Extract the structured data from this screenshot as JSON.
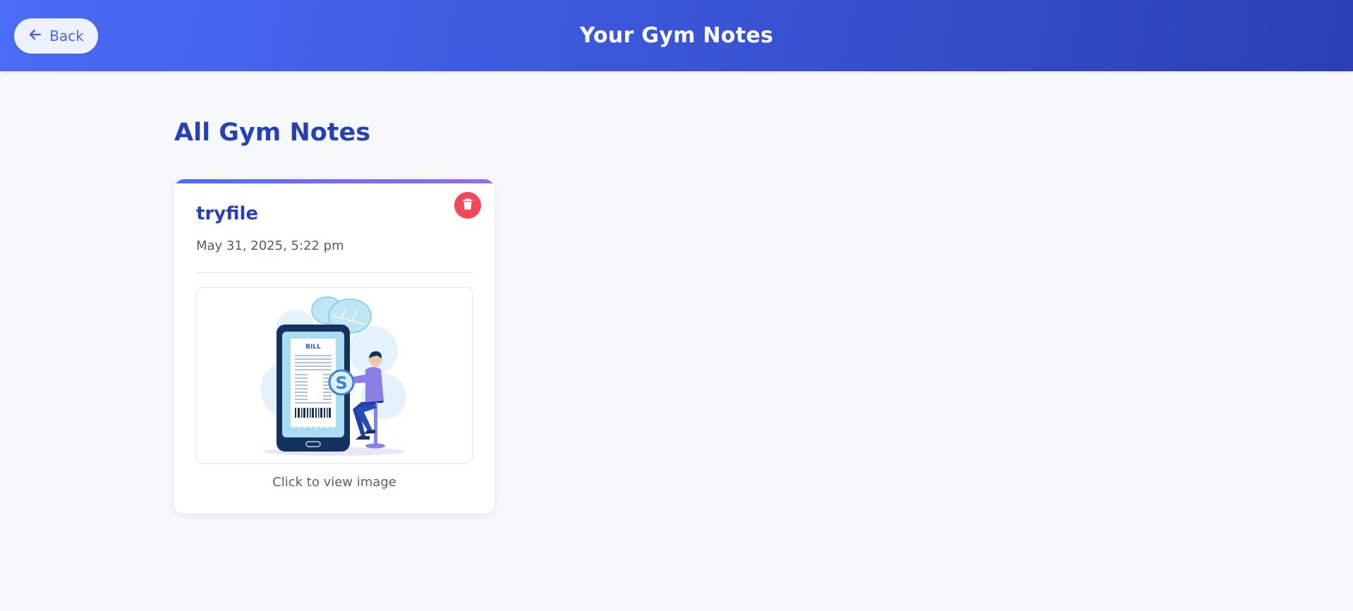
{
  "header": {
    "back_label": "Back",
    "title": "Your Gym Notes"
  },
  "main": {
    "section_title": "All Gym Notes",
    "notes": [
      {
        "title": "tryfile",
        "date": "May 31, 2025, 5:22 pm",
        "image_label": "BILL",
        "image_caption": "Click to view image"
      }
    ]
  },
  "colors": {
    "header_start": "#4a6cf7",
    "header_end": "#2a40b4",
    "accent_text": "#2740b3",
    "delete": "#f24857",
    "background": "#f7f8fa"
  },
  "icons": {
    "back": "arrow-left-icon",
    "delete": "trash-icon"
  }
}
